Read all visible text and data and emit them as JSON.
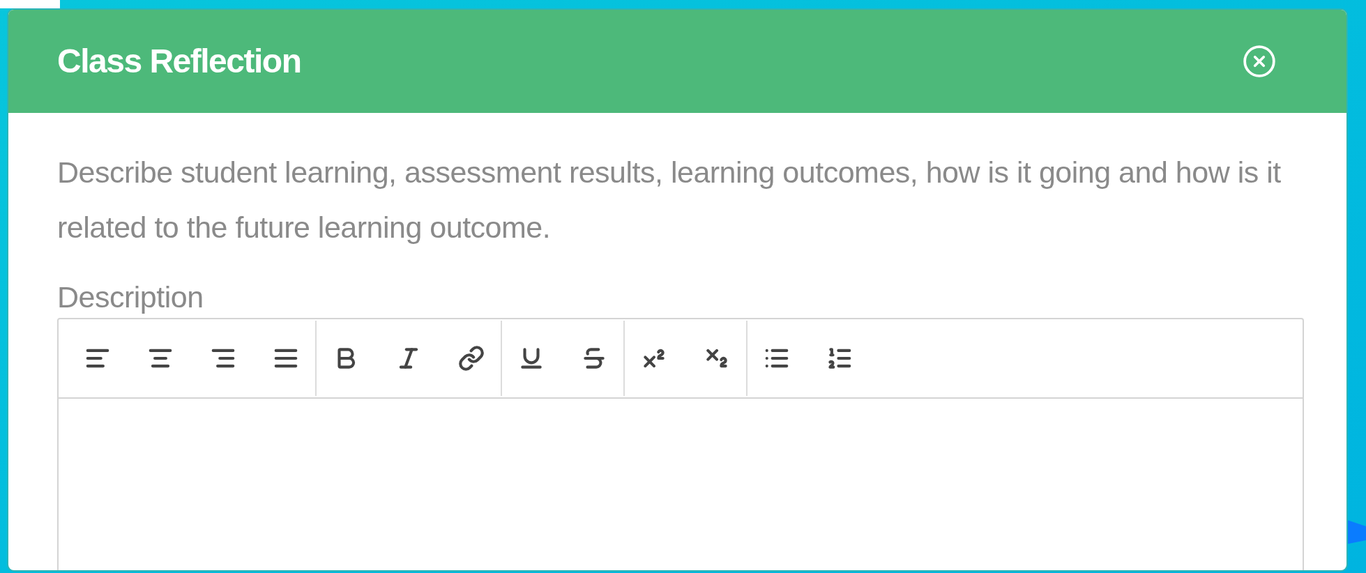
{
  "dialog": {
    "title": "Class Reflection",
    "instructions": "Describe student learning, assessment results, learning outcomes, how is it going and how is it related to the future learning outcome.",
    "field_label": "Description",
    "toolbar": [
      {
        "buttons": [
          {
            "kind": "align-left"
          },
          {
            "kind": "align-center"
          },
          {
            "kind": "align-right"
          },
          {
            "kind": "align-justify"
          }
        ]
      },
      {
        "buttons": [
          {
            "kind": "bold"
          },
          {
            "kind": "italic"
          },
          {
            "kind": "link"
          }
        ]
      },
      {
        "buttons": [
          {
            "kind": "underline"
          },
          {
            "kind": "strikethrough"
          }
        ]
      },
      {
        "buttons": [
          {
            "kind": "superscript"
          },
          {
            "kind": "subscript"
          }
        ]
      },
      {
        "buttons": [
          {
            "kind": "bullet-list"
          },
          {
            "kind": "numbered-list"
          }
        ]
      }
    ]
  }
}
